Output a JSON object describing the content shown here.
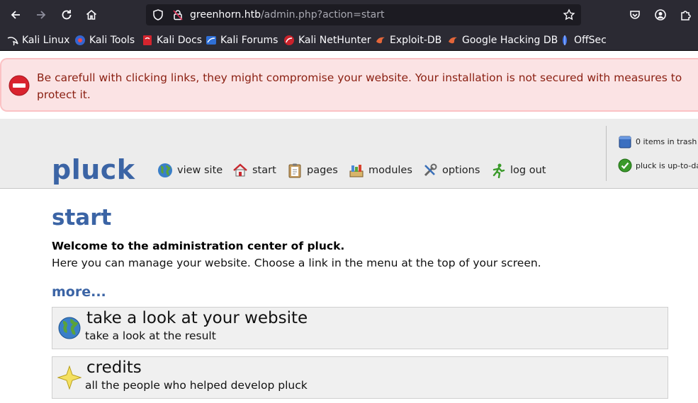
{
  "browser": {
    "url_host": "greenhorn.htb",
    "url_path": "/admin.php?action=start",
    "bookmarks": [
      {
        "label": "Kali Linux",
        "icon": "kali-dragon-icon"
      },
      {
        "label": "Kali Tools",
        "icon": "kali-tools-icon"
      },
      {
        "label": "Kali Docs",
        "icon": "kali-docs-icon"
      },
      {
        "label": "Kali Forums",
        "icon": "kali-forums-icon"
      },
      {
        "label": "Kali NetHunter",
        "icon": "kali-nethunter-icon"
      },
      {
        "label": "Exploit-DB",
        "icon": "exploit-db-icon"
      },
      {
        "label": "Google Hacking DB",
        "icon": "ghdb-icon"
      },
      {
        "label": "OffSec",
        "icon": "offsec-icon"
      }
    ]
  },
  "warning": {
    "message": "Be carefull with clicking links, they might compromise your website. Your installation is not secured with measures to protect it."
  },
  "header": {
    "logo": "pluck",
    "menu": [
      {
        "label": "view site",
        "icon": "globe-icon"
      },
      {
        "label": "start",
        "icon": "home-icon"
      },
      {
        "label": "pages",
        "icon": "clipboard-icon"
      },
      {
        "label": "modules",
        "icon": "modules-icon"
      },
      {
        "label": "options",
        "icon": "tools-icon"
      },
      {
        "label": "log out",
        "icon": "running-man-icon"
      }
    ],
    "side": {
      "trash": "0 items in trash",
      "status": "pluck is up-to-date"
    }
  },
  "content": {
    "title": "start",
    "welcome_bold": "Welcome to the administration center of pluck.",
    "welcome_text": "Here you can manage your website. Choose a link in the menu at the top of your screen.",
    "more": "more...",
    "cards": [
      {
        "title": "take a look at your website",
        "subtitle": "take a look at the result",
        "icon": "globe-icon"
      },
      {
        "title": "credits",
        "subtitle": "all the people who helped develop pluck",
        "icon": "star-icon"
      }
    ]
  },
  "colors": {
    "accent": "#3b64a5",
    "warning_bg": "#fbe3e4",
    "warning_text": "#8a1f11",
    "browser_chrome": "#2b2a33"
  }
}
